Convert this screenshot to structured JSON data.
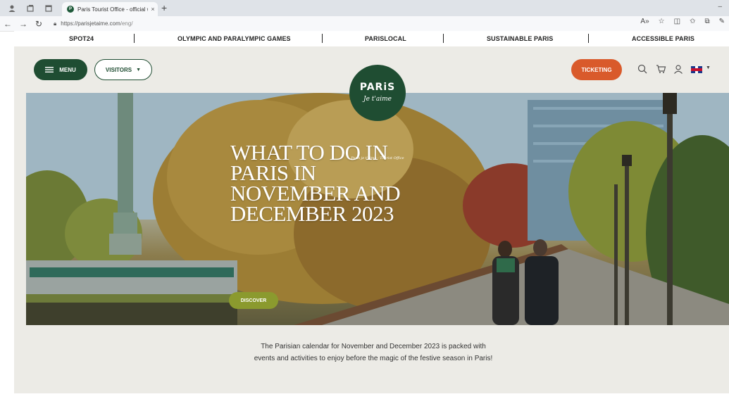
{
  "browser": {
    "tab_title": "Paris Tourist Office - official web",
    "tab_close": "×",
    "new_tab": "+",
    "minimize": "–",
    "url_host": "https://parisjetaime.com",
    "url_path": "/eng/"
  },
  "topnav": {
    "items": [
      "SPOT24",
      "OLYMPIC AND PARALYMPIC GAMES",
      "PARISLOCAL",
      "SUSTAINABLE PARIS",
      "ACCESSIBLE PARIS"
    ]
  },
  "header": {
    "menu_label": "MENU",
    "visitors_label": "VISITORS",
    "ticketing_label": "TICKETING",
    "logo_main": "PARiS",
    "logo_script": "Je t'aime",
    "logo_caption": "Paris je t'aime - Tourist Office"
  },
  "hero": {
    "title": "WHAT TO DO IN PARIS IN NOVEMBER AND DECEMBER 2023",
    "discover_label": "DISCOVER"
  },
  "intro": {
    "text": "The Parisian calendar for November and December 2023 is packed with events and activities to enjoy before the magic of the festive season in Paris!"
  },
  "colors": {
    "brand_green": "#1f4d32",
    "ticketing_orange": "#d95a2b",
    "discover_olive": "#8b9a2e",
    "page_bg": "#ecebe6"
  }
}
